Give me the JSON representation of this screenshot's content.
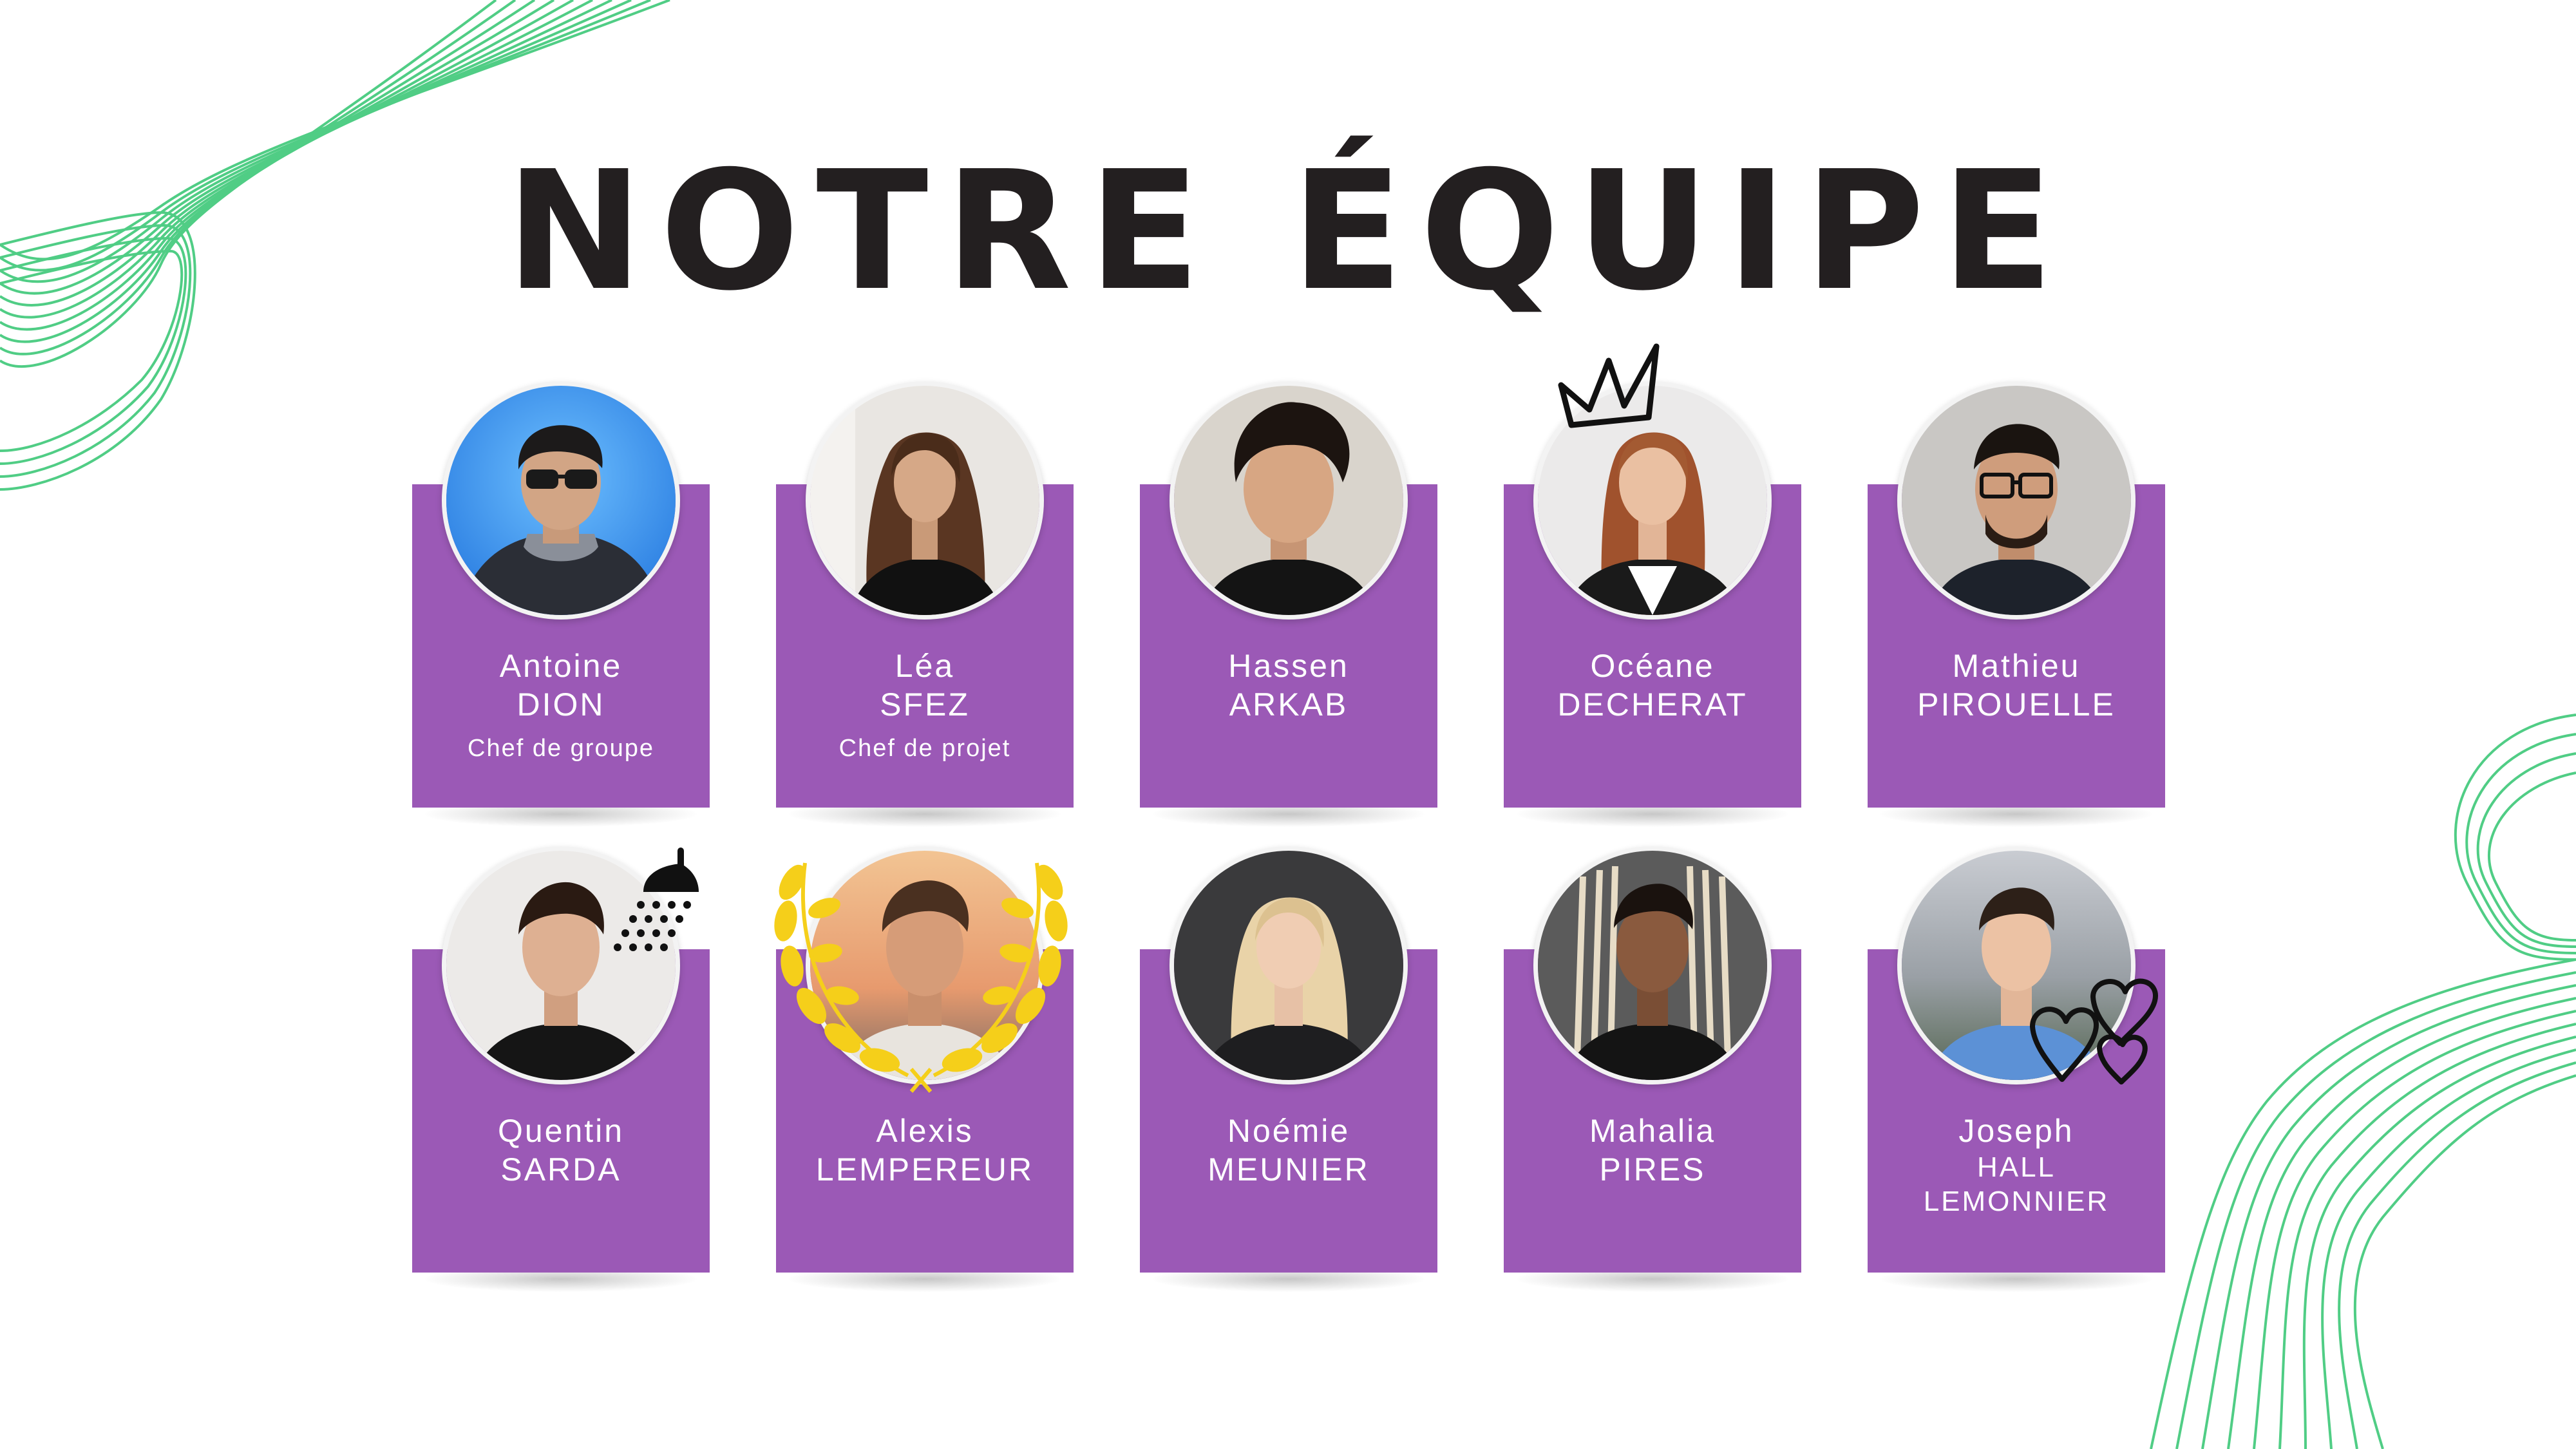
{
  "title": "NOTRE ÉQUIPE",
  "colors": {
    "card": "#9b59b6",
    "title": "#231f20",
    "accent_green": "#3ec878",
    "laurel": "#f5cf1a"
  },
  "team": [
    {
      "first": "Antoine",
      "last": "DION",
      "role": "Chef de groupe"
    },
    {
      "first": "Léa",
      "last": "SFEZ",
      "role": "Chef de projet"
    },
    {
      "first": "Hassen",
      "last": "ARKAB"
    },
    {
      "first": "Océane",
      "last": "DECHERAT",
      "badge": "crown-icon"
    },
    {
      "first": "Mathieu",
      "last": "PIROUELLE"
    },
    {
      "first": "Quentin",
      "last": "SARDA",
      "badge": "shower-icon"
    },
    {
      "first": "Alexis",
      "last": "LEMPEREUR",
      "badge": "laurel-wreath-icon"
    },
    {
      "first": "Noémie",
      "last": "MEUNIER"
    },
    {
      "first": "Mahalia",
      "last": "PIRES"
    },
    {
      "first": "Joseph",
      "last": "HALL",
      "last2": "LEMONNIER",
      "badge": "hearts-icon"
    }
  ]
}
